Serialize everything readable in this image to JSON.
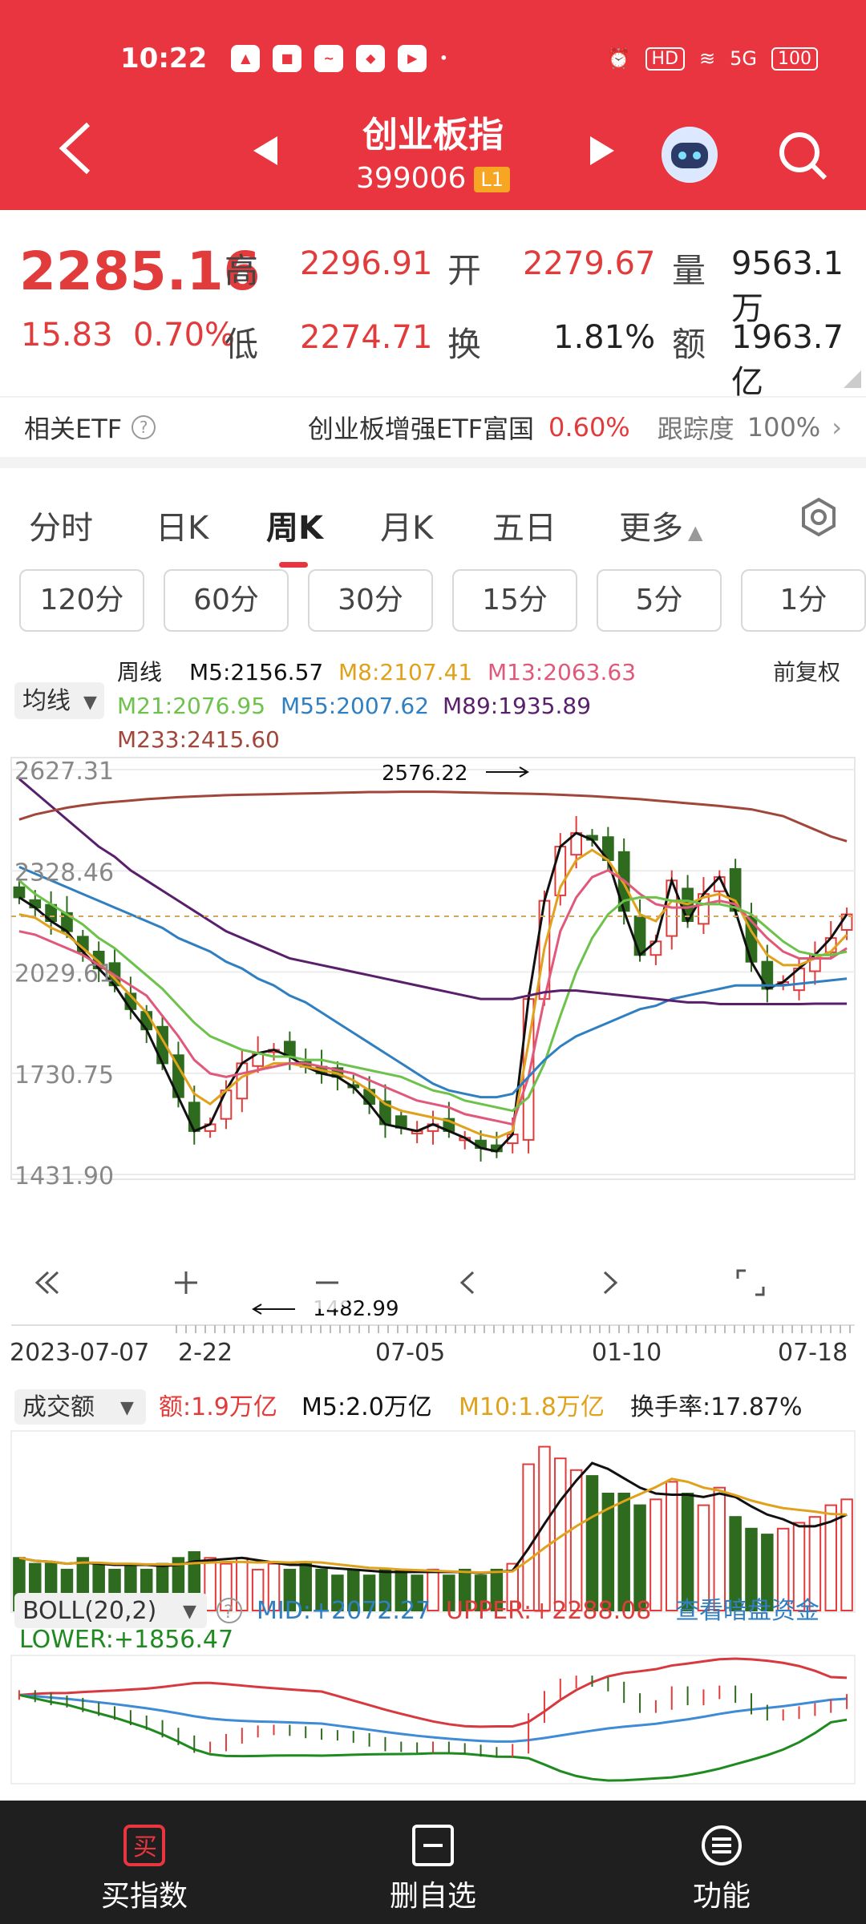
{
  "status_bar": {
    "time": "10:22",
    "hd": "HD",
    "signal": "5G",
    "battery": "100"
  },
  "header": {
    "title": "创业板指",
    "code": "399006",
    "level": "L1"
  },
  "quote": {
    "price": "2285.16",
    "change": "15.83",
    "change_pct": "0.70%",
    "high_label": "高",
    "high": "2296.91",
    "open_label": "开",
    "open": "2279.67",
    "volume_label": "量",
    "volume": "9563.1万",
    "low_label": "低",
    "low": "2274.71",
    "turnover_label": "换",
    "turnover": "1.81%",
    "amount_label": "额",
    "amount": "1963.7亿"
  },
  "etf": {
    "label": "相关ETF",
    "fund": "创业板增强ETF富国",
    "fund_pct": "0.60%",
    "track_label": "跟踪度",
    "track_value": "100%"
  },
  "tabs": [
    "分时",
    "日K",
    "周K",
    "月K",
    "五日",
    "更多"
  ],
  "active_tab": "周K",
  "periods": [
    "120分",
    "60分",
    "30分",
    "15分",
    "5分",
    "1分"
  ],
  "ma_panel": {
    "selector": "均线",
    "period_label": "周线",
    "adjust": "前复权",
    "m5": "M5:2156.57",
    "m8": "M8:2107.41",
    "m13": "M13:2063.63",
    "m21": "M21:2076.95",
    "m55": "M55:2007.62",
    "m89": "M89:1935.89",
    "m233": "M233:2415.60"
  },
  "colors": {
    "up": "#e23b3b",
    "down": "#2e6b1e",
    "m5": "#111111",
    "m8": "#e0a21c",
    "m13": "#e0587a",
    "m21": "#6cc24a",
    "m55": "#2f7fc1",
    "m89": "#5a1f6b",
    "m233": "#a0463a"
  },
  "chart_data": [
    {
      "type": "candlestick",
      "y_tick_labels": [
        "2627.31",
        "2328.46",
        "2029.61",
        "1730.75",
        "1431.90"
      ],
      "ylim": [
        1431.9,
        2627.31
      ],
      "x_tick_labels": [
        "2023-07-07",
        "2-22",
        "07-05",
        "01-10",
        "07-18"
      ],
      "annotations": [
        {
          "text": "2576.22",
          "value": 2576.22
        },
        {
          "text": "1482.99",
          "value": 1482.99
        }
      ],
      "series": [
        {
          "name": "M5",
          "values": [
            2250,
            2220,
            2180,
            2150,
            2090,
            2040,
            1990,
            1920,
            1860,
            1760,
            1660,
            1560,
            1580,
            1680,
            1760,
            1790,
            1800,
            1780,
            1750,
            1730,
            1720,
            1690,
            1640,
            1580,
            1570,
            1560,
            1580,
            1560,
            1540,
            1510,
            1500,
            1550,
            1950,
            2240,
            2400,
            2440,
            2420,
            2360,
            2210,
            2080,
            2120,
            2300,
            2180,
            2260,
            2310,
            2210,
            2060,
            1980,
            2000,
            2040,
            2080,
            2130,
            2200
          ]
        },
        {
          "name": "M8",
          "values": [
            2200,
            2190,
            2160,
            2140,
            2100,
            2060,
            2010,
            1960,
            1910,
            1830,
            1750,
            1670,
            1640,
            1680,
            1720,
            1740,
            1760,
            1760,
            1750,
            1740,
            1730,
            1710,
            1680,
            1640,
            1620,
            1610,
            1600,
            1590,
            1570,
            1550,
            1540,
            1560,
            1820,
            2100,
            2280,
            2360,
            2390,
            2360,
            2290,
            2200,
            2180,
            2240,
            2230,
            2250,
            2260,
            2240,
            2150,
            2080,
            2050,
            2050,
            2070,
            2090,
            2140
          ]
        },
        {
          "name": "M13",
          "values": [
            2150,
            2140,
            2120,
            2100,
            2080,
            2050,
            2020,
            1990,
            1960,
            1900,
            1840,
            1770,
            1730,
            1720,
            1730,
            1740,
            1750,
            1760,
            1760,
            1750,
            1740,
            1730,
            1710,
            1690,
            1670,
            1650,
            1640,
            1630,
            1610,
            1600,
            1590,
            1580,
            1720,
            1950,
            2150,
            2250,
            2310,
            2330,
            2300,
            2260,
            2230,
            2220,
            2220,
            2230,
            2240,
            2230,
            2180,
            2130,
            2090,
            2070,
            2070,
            2070,
            2100
          ]
        },
        {
          "name": "M21",
          "values": [
            2300,
            2260,
            2230,
            2200,
            2170,
            2130,
            2100,
            2060,
            2020,
            1980,
            1930,
            1880,
            1840,
            1820,
            1800,
            1790,
            1780,
            1780,
            1770,
            1770,
            1760,
            1750,
            1740,
            1730,
            1720,
            1700,
            1680,
            1670,
            1650,
            1640,
            1630,
            1620,
            1660,
            1760,
            1900,
            2030,
            2130,
            2200,
            2240,
            2250,
            2250,
            2240,
            2240,
            2230,
            2230,
            2220,
            2200,
            2160,
            2120,
            2090,
            2080,
            2080,
            2090
          ]
        },
        {
          "name": "M55",
          "values": [
            2340,
            2320,
            2300,
            2280,
            2260,
            2240,
            2220,
            2200,
            2180,
            2160,
            2130,
            2110,
            2090,
            2060,
            2040,
            2010,
            1990,
            1960,
            1940,
            1910,
            1880,
            1850,
            1820,
            1790,
            1760,
            1730,
            1700,
            1680,
            1670,
            1660,
            1660,
            1670,
            1720,
            1770,
            1810,
            1840,
            1860,
            1880,
            1900,
            1920,
            1930,
            1950,
            1960,
            1970,
            1980,
            1990,
            1990,
            1990,
            1990,
            1995,
            2000,
            2005,
            2010
          ]
        },
        {
          "name": "M89",
          "values": [
            2600,
            2560,
            2520,
            2480,
            2440,
            2400,
            2370,
            2330,
            2300,
            2270,
            2240,
            2210,
            2180,
            2150,
            2130,
            2110,
            2090,
            2070,
            2060,
            2050,
            2040,
            2030,
            2020,
            2010,
            2000,
            1990,
            1980,
            1970,
            1960,
            1950,
            1950,
            1950,
            1960,
            1970,
            1975,
            1975,
            1970,
            1965,
            1960,
            1955,
            1950,
            1945,
            1940,
            1940,
            1935,
            1935,
            1935,
            1935,
            1935,
            1935,
            1936,
            1936,
            1936
          ]
        },
        {
          "name": "M233",
          "values": [
            2480,
            2495,
            2505,
            2515,
            2522,
            2528,
            2532,
            2536,
            2540,
            2543,
            2546,
            2548,
            2550,
            2552,
            2553,
            2554,
            2555,
            2556,
            2557,
            2558,
            2559,
            2560,
            2561,
            2561,
            2562,
            2562,
            2562,
            2561,
            2560,
            2559,
            2558,
            2557,
            2556,
            2555,
            2553,
            2551,
            2549,
            2546,
            2543,
            2540,
            2536,
            2532,
            2528,
            2524,
            2520,
            2515,
            2510,
            2500,
            2490,
            2470,
            2450,
            2430,
            2416
          ]
        }
      ]
    },
    {
      "type": "bar",
      "title": "成交额",
      "amount_label": "额:1.9万亿",
      "m5_label": "M5:2.0万亿",
      "m10_label": "M10:1.8万亿",
      "turnover_label": "换手率:17.87%",
      "values": [
        0.9,
        0.8,
        0.8,
        0.7,
        0.9,
        0.8,
        0.7,
        0.8,
        0.7,
        0.8,
        0.9,
        1.0,
        0.9,
        0.8,
        0.9,
        0.7,
        0.8,
        0.7,
        0.8,
        0.7,
        0.6,
        0.7,
        0.6,
        0.7,
        0.7,
        0.6,
        0.7,
        0.6,
        0.7,
        0.6,
        0.7,
        0.8,
        2.5,
        2.8,
        2.6,
        2.4,
        2.3,
        2.0,
        2.0,
        1.8,
        1.9,
        2.2,
        2.0,
        1.8,
        2.1,
        1.6,
        1.4,
        1.3,
        1.4,
        1.5,
        1.6,
        1.8,
        1.9
      ]
    },
    {
      "type": "line",
      "title": "BOLL(20,2)",
      "mid_label": "MID:+2072.27",
      "upper_label": "UPPER:+2288.08",
      "lower_label": "LOWER:+1856.47",
      "link": "查看暗盘资金"
    }
  ],
  "bottom_nav": [
    {
      "label": "买指数",
      "icon": "买"
    },
    {
      "label": "删自选"
    },
    {
      "label": "功能"
    }
  ]
}
